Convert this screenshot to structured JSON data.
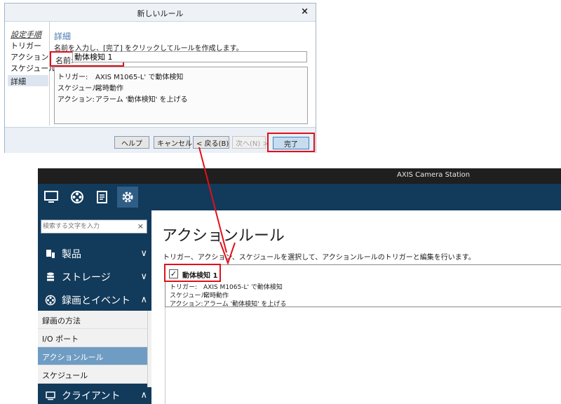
{
  "dialog": {
    "title": "新しいルール",
    "close_glyph": "×",
    "steps_header": "設定手順",
    "steps": [
      "トリガー",
      "アクション",
      "スケジュール",
      "詳細"
    ],
    "selected_step": "詳細",
    "section_title": "詳細",
    "instruction": "名前を入力し、[完了] をクリックしてルールを作成します。",
    "name_label": "名前:",
    "name_value": "動体検知 1",
    "summary": [
      {
        "key": "トリガー:",
        "value": "AXIS M1065-L' で動体検知"
      },
      {
        "key": "スケジュール:",
        "value": "常時動作"
      },
      {
        "key": "アクション:",
        "value": "アラーム '動体検知' を上げる"
      }
    ],
    "buttons": {
      "help": "ヘルプ",
      "cancel": "キャンセル",
      "back": "< 戻る(B)",
      "next": "次へ(N) >",
      "done": "完了"
    }
  },
  "app": {
    "title": "AXIS Camera Station",
    "toolbar_icons": [
      "monitor-icon",
      "film-reel-icon",
      "log-icon",
      "gear-icon"
    ],
    "search": {
      "placeholder": "検索する文字を入力",
      "clear_glyph": "×"
    },
    "categories": [
      {
        "label": "製品",
        "icon": "device-icon",
        "chevron": "∨"
      },
      {
        "label": "ストレージ",
        "icon": "database-icon",
        "chevron": "∨"
      },
      {
        "label": "録画とイベント",
        "icon": "film-reel-icon",
        "chevron": "∧"
      },
      {
        "label": "クライアント",
        "icon": "client-icon",
        "chevron": "∧"
      }
    ],
    "items": [
      "録画の方法",
      "I/O ポート",
      "アクションルール",
      "スケジュール"
    ],
    "selected_item": "アクションルール",
    "main": {
      "title": "アクションルール",
      "description": "トリガー、アクション、スケジュールを選択して、アクションルールのトリガーと編集を行います。",
      "rule": {
        "checked": true,
        "check_glyph": "✓",
        "name": "動体検知 1",
        "lines": [
          {
            "key": "トリガー:",
            "value": "AXIS M1065-L' で動体検知"
          },
          {
            "key": "スケジュール:",
            "value": "常時動作"
          },
          {
            "key": "アクション:",
            "value": "アラーム '動体検知' を上げる"
          }
        ]
      }
    }
  },
  "colors": {
    "highlight": "#e0101a",
    "nav_dark": "#123a5b",
    "nav_selected": "#6f9cc3",
    "titlebar": "#1f1f1f"
  }
}
